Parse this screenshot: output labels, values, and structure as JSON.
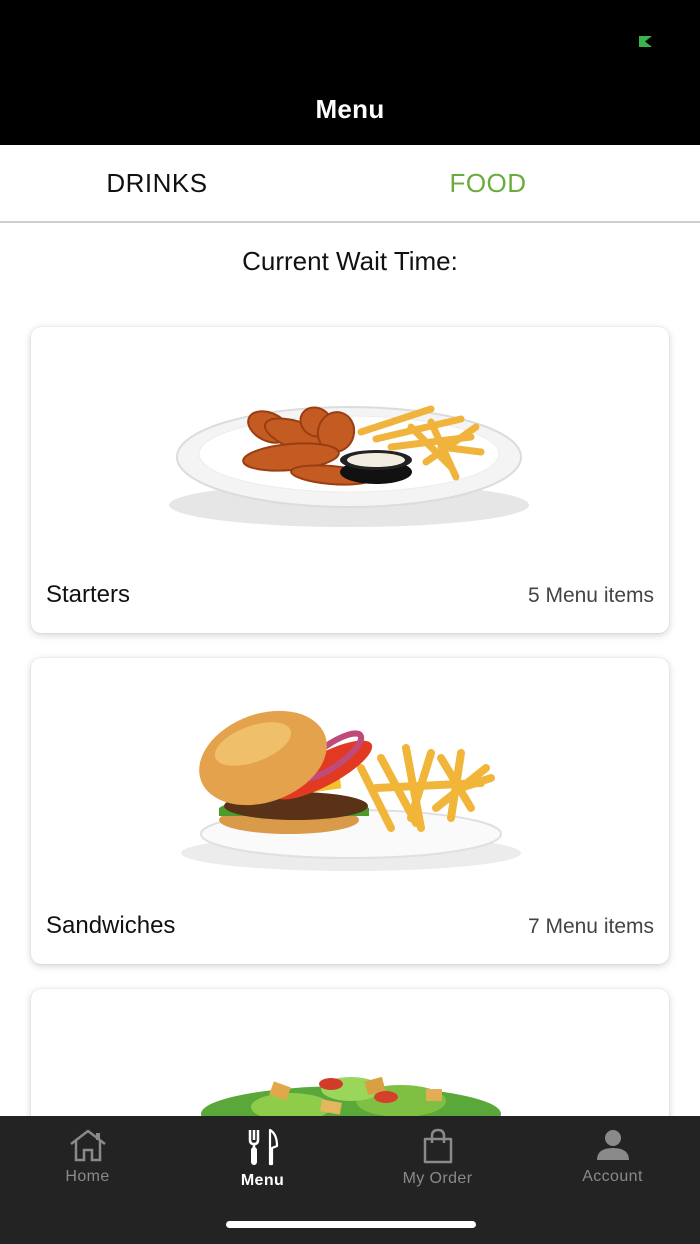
{
  "header": {
    "title": "Menu",
    "status_color": "#3ab54a"
  },
  "tabs": [
    {
      "label": "DRINKS",
      "active": false
    },
    {
      "label": "FOOD",
      "active": true
    }
  ],
  "accent_color": "#6aac3b",
  "wait_time": {
    "label": "Current Wait Time:"
  },
  "categories": [
    {
      "name": "Starters",
      "count": "5 Menu items",
      "image_icon": "chicken-tenders-fries-plate"
    },
    {
      "name": "Sandwiches",
      "count": "7 Menu items",
      "image_icon": "burger-fries-plate"
    },
    {
      "name": "",
      "count": "",
      "image_icon": "caesar-salad"
    }
  ],
  "tabbar": {
    "items": [
      {
        "label": "Home",
        "icon": "home-icon",
        "active": false
      },
      {
        "label": "Menu",
        "icon": "fork-knife-icon",
        "active": true
      },
      {
        "label": "My Order",
        "icon": "shopping-bag-icon",
        "active": false
      },
      {
        "label": "Account",
        "icon": "person-icon",
        "active": false
      }
    ]
  }
}
